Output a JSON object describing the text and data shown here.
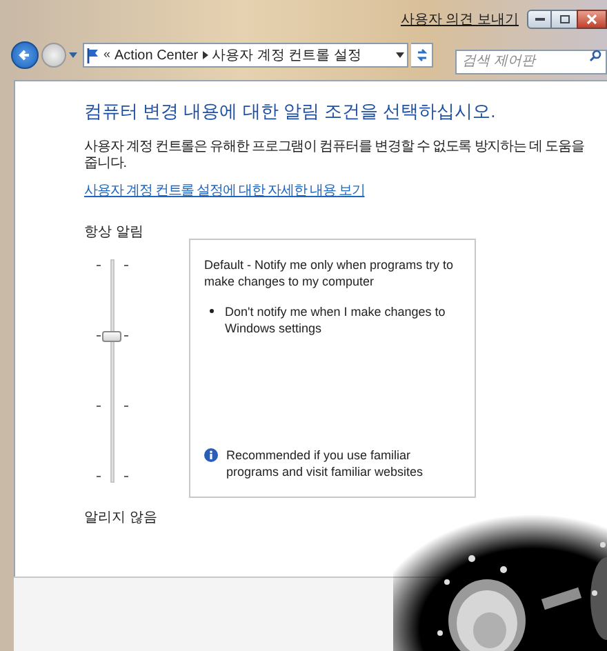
{
  "title_bar": {
    "feedback_link": "사용자 의견 보내기"
  },
  "navigation": {
    "breadcrumb_prefix": "«",
    "breadcrumbs": [
      "Action Center",
      "사용자 계정 컨트롤 설정"
    ],
    "search": {
      "placeholder": "검색 제어판"
    }
  },
  "content": {
    "heading": "컴퓨터 변경 내용에 대한 알림 조건을 선택하십시오.",
    "description": "사용자 계정 컨트롤은 유해한 프로그램이 컴퓨터를 변경할 수 없도록 방지하는 데 도움을 줍니다.",
    "help_link": "사용자 계정 컨트롤 설정에 대한 자세한 내용 보기"
  },
  "slider": {
    "top_label": "항상 알림",
    "bottom_label": "알리지 않음",
    "level": 0.667
  },
  "description_box": {
    "title": "Default - Notify me only when programs try to make changes to my computer",
    "bullets": [
      "Don't notify me when I make changes to Windows settings"
    ],
    "note": "Recommended if you use familiar programs and visit familiar websites"
  }
}
